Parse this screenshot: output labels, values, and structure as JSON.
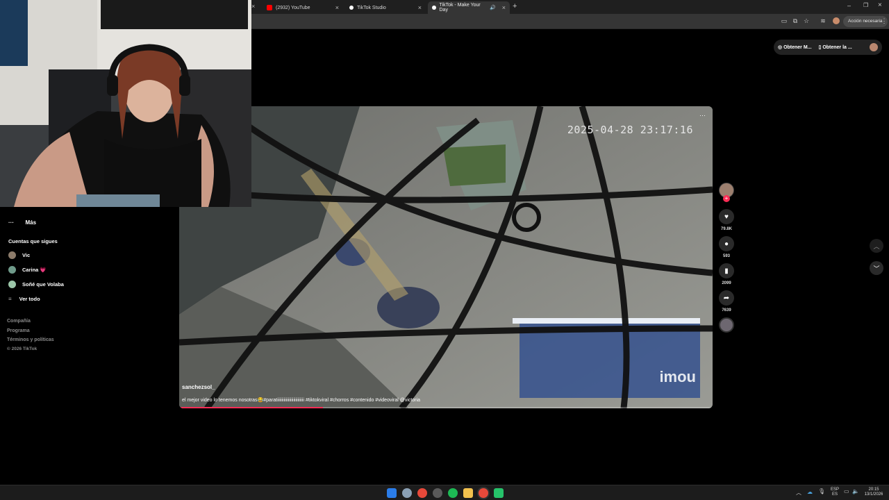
{
  "tabs": [
    {
      "label": "(2932) YouTube",
      "color": "#ff0000"
    },
    {
      "label": "TikTok Studio",
      "color": "#ffffff"
    },
    {
      "label": "TikTok - Make Your Day",
      "color": "#ffffff"
    }
  ],
  "new_tab_glyph": "+",
  "toolbar": {
    "action_badge": "Acción necesaria"
  },
  "header_pill": {
    "item1": "Obtener M...",
    "item2": "Obtener la ..."
  },
  "sidebar": {
    "more_label": "Más",
    "following_heading": "Cuentas que sigues",
    "following": [
      {
        "name": "Vic",
        "color": "#8c7b6a"
      },
      {
        "name": "Carina 💗",
        "color": "#6f9a8a"
      },
      {
        "name": "Soñé que Volaba",
        "color": "#9bc6a8"
      }
    ],
    "see_all": "Ver todo",
    "footer": [
      "Compañía",
      "Programa",
      "Términos y políticas",
      "© 2026 TikTok"
    ]
  },
  "video": {
    "timestamp": "2025-04-28 23:17:16",
    "watermark": "imou",
    "author": "sanchezsol_",
    "caption": "el mejor video lo tenemos nosotras😂#paratiiiiiiiiiiiiiiiiiiiiiiiii #tiktokviral #chorros #contenido #videoviral @victoria",
    "progress": 0.27,
    "more_glyph": "···"
  },
  "actions": {
    "likes": "79.8K",
    "comments": "593",
    "saves": "2099",
    "shares": "7639"
  },
  "taskbar": {
    "lang_top": "ESP",
    "lang_bottom": "ES",
    "time": "20:15",
    "date": "13/1/2026"
  }
}
